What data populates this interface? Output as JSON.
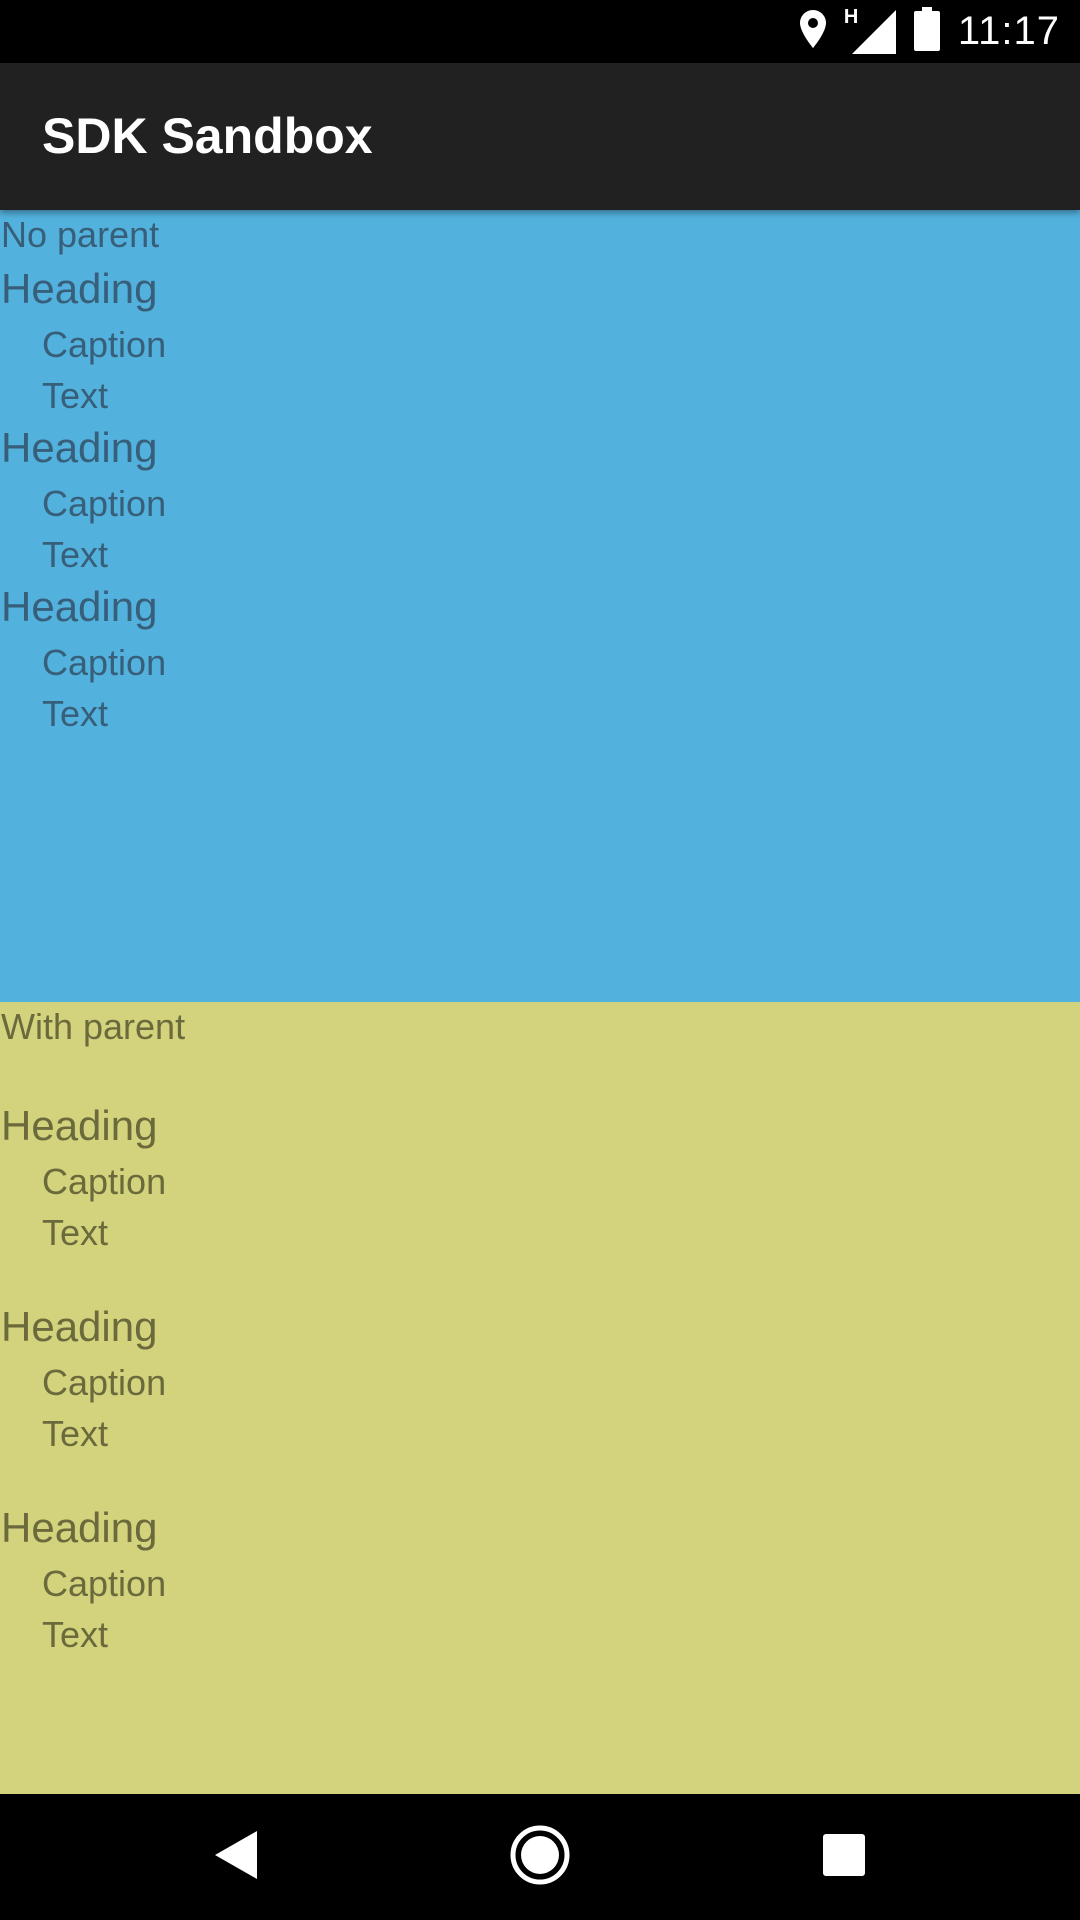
{
  "status_bar": {
    "time": "11:17",
    "network_label": "H",
    "icons": [
      "location-icon",
      "signal-icon",
      "battery-icon"
    ]
  },
  "app_bar": {
    "title": "SDK Sandbox"
  },
  "no_parent_section": {
    "label": "No parent",
    "background": "#53b1dd",
    "groups": [
      {
        "heading": "Heading",
        "caption": "Caption",
        "text": "Text"
      },
      {
        "heading": "Heading",
        "caption": "Caption",
        "text": "Text"
      },
      {
        "heading": "Heading",
        "caption": "Caption",
        "text": "Text"
      }
    ]
  },
  "with_parent_section": {
    "label": "With parent",
    "background": "#d2d37c",
    "groups": [
      {
        "heading": "Heading",
        "caption": "Caption",
        "text": "Text"
      },
      {
        "heading": "Heading",
        "caption": "Caption",
        "text": "Text"
      },
      {
        "heading": "Heading",
        "caption": "Caption",
        "text": "Text"
      }
    ]
  },
  "nav_bar": {
    "buttons": [
      "back-icon",
      "home-icon",
      "recents-icon"
    ]
  }
}
